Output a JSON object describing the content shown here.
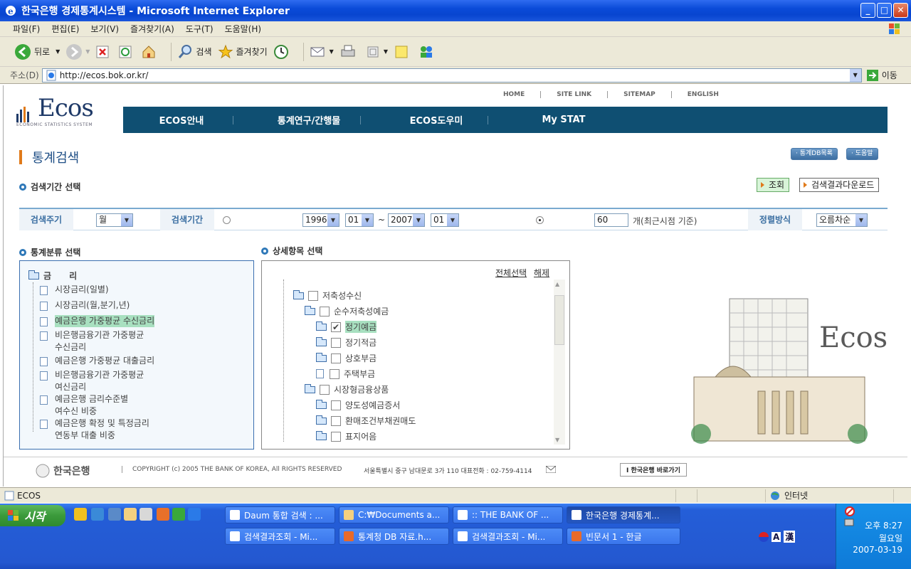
{
  "window": {
    "title": "한국은행 경제통계시스템 - Microsoft Internet Explorer",
    "buttons": [
      "_",
      "□",
      "✕"
    ]
  },
  "menu": [
    "파일(F)",
    "편집(E)",
    "보기(V)",
    "즐겨찾기(A)",
    "도구(T)",
    "도움말(H)"
  ],
  "toolbar": {
    "back": "뒤로",
    "search": "검색",
    "favorites": "즐겨찾기"
  },
  "address": {
    "label": "주소(D)",
    "url": "http://ecos.bok.or.kr/",
    "go": "이동"
  },
  "site": {
    "logo_word": "Ecos",
    "logo_sub": "ECONOMIC STATISTICS SYSTEM",
    "topnav": [
      "HOME",
      "SITE LINK",
      "SITEMAP",
      "ENGLISH"
    ],
    "mainnav": [
      "ECOS안내",
      "통계연구/간행물",
      "ECOS도우미",
      "My STAT"
    ],
    "page_title": "통계검색",
    "btn_dblist": "· 통계DB목록",
    "btn_help": "· 도움말"
  },
  "period": {
    "heading": "검색기간 선택",
    "btn_search": "조회",
    "btn_download": "검색결과다운로드",
    "cycle_label": "검색주기",
    "cycle_value": "월",
    "range_label": "검색기간",
    "from_year": "1996",
    "from_month": "01",
    "tilde": "~",
    "to_year": "2007",
    "to_month": "01",
    "count_value": "60",
    "count_suffix": "개(최근시점 기준)",
    "sort_label": "정렬방식",
    "sort_value": "오름차순"
  },
  "category": {
    "heading": "통계분류 선택",
    "root": "금      리",
    "items": [
      "시장금리(일별)",
      "시장금리(월,분기,년)",
      "예금은행 가중평균 수신금리",
      "비은행금융기관 가중평균\n수신금리",
      "예금은행 가중평균 대출금리",
      "비은행금융기관 가중평균\n여신금리",
      "예금은행 금리수준별\n여수신 비중",
      "예금은행 확정 및 특정금리\n연동부 대출 비중"
    ]
  },
  "detail": {
    "heading": "상세항목 선택",
    "select_all": "전체선택",
    "clear": "해제",
    "nodes": [
      {
        "label": "저축성수신",
        "checked": false
      },
      {
        "label": "순수저축성예금",
        "checked": false
      },
      {
        "label": "정기예금",
        "checked": true
      },
      {
        "label": "정기적금",
        "checked": false
      },
      {
        "label": "상호부금",
        "checked": false
      },
      {
        "label": "주택부금",
        "checked": false
      },
      {
        "label": "시장형금융상품",
        "checked": false
      },
      {
        "label": "양도성예금증서",
        "checked": false
      },
      {
        "label": "환매조건부채권매도",
        "checked": false
      },
      {
        "label": "표지어음",
        "checked": false
      }
    ]
  },
  "illustration": {
    "word": "Ecos"
  },
  "footer": {
    "bok": "한국은행",
    "copyright": "COPYRIGHT (c) 2005 THE BANK OF KOREA, All RIGHTS RESERVED",
    "address": "서울특별시 중구 남대문로 3가 110  대표전화 : 02-759-4114",
    "shortcut": "I 한국은행 바로가기"
  },
  "status": {
    "text": "ECOS",
    "zone": "인터넷"
  },
  "taskbar": {
    "start": "시작",
    "tasks_row1": [
      "Daum 통합 검색 : ...",
      "C:₩Documents a...",
      ":: THE BANK OF ...",
      "한국은행 경제통계..."
    ],
    "tasks_row2": [
      "검색결과조회 - Mi...",
      "통계청 DB 자료.h...",
      "검색결과조회 - Mi...",
      "빈문서 1 - 한글"
    ],
    "clock": "오후 8:27",
    "day": "월요일",
    "date": "2007-03-19",
    "ime": [
      "A",
      "漢"
    ]
  }
}
